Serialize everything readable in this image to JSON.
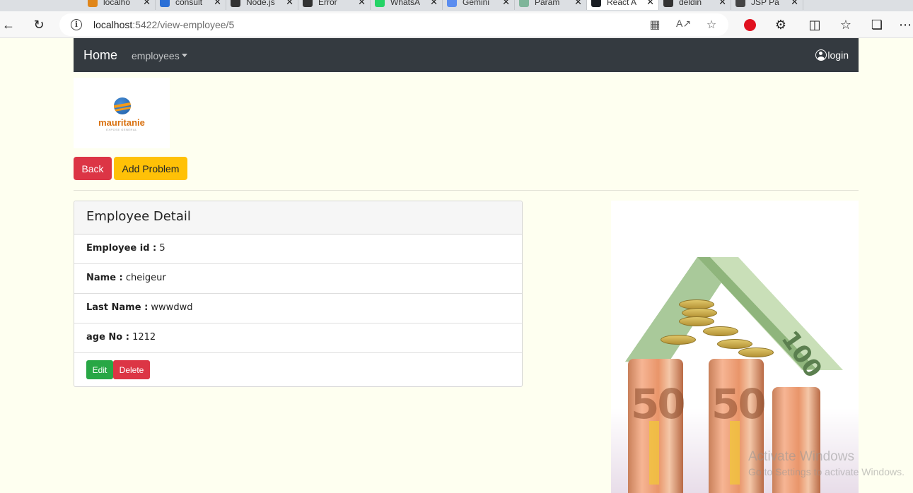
{
  "browser": {
    "tabs": [
      {
        "title": "localho",
        "favicon_color": "#e0861a"
      },
      {
        "title": "consult",
        "favicon_color": "#2b6fd6"
      },
      {
        "title": "Node.js",
        "favicon_color": "#333333"
      },
      {
        "title": "Error",
        "favicon_color": "#333333"
      },
      {
        "title": "WhatsA",
        "favicon_color": "#25d366"
      },
      {
        "title": "Gemini",
        "favicon_color": "#5b8def"
      },
      {
        "title": "Param",
        "favicon_color": "#7fb59a"
      },
      {
        "title": "React A",
        "favicon_color": "#1b1f24",
        "active": true
      },
      {
        "title": "deldin",
        "favicon_color": "#333333"
      },
      {
        "title": "JSP Pa",
        "favicon_color": "#444444"
      }
    ],
    "url_host": "localhost",
    "url_path": ":5422/view-employee/5"
  },
  "navbar": {
    "brand": "Home",
    "dropdown": "employees",
    "login": "login"
  },
  "logo": {
    "text": "mauritanie",
    "subtext": "EXPOSE GENERAL"
  },
  "toolbar": {
    "back_label": "Back",
    "add_problem_label": "Add Problem"
  },
  "card": {
    "title": "Employee Detail",
    "fields": [
      {
        "label": "Employee id :",
        "value": "5"
      },
      {
        "label": "Name :",
        "value": "cheigeur"
      },
      {
        "label": "Last Name :",
        "value": "wwwdwd"
      },
      {
        "label": "age No :",
        "value": "1212"
      }
    ],
    "edit_label": "Edit",
    "delete_label": "Delete"
  },
  "image": {
    "note_50_a": "50",
    "note_50_b": "50"
  },
  "watermark": {
    "line1": "Activate Windows",
    "line2": "Go to Settings to activate Windows."
  }
}
